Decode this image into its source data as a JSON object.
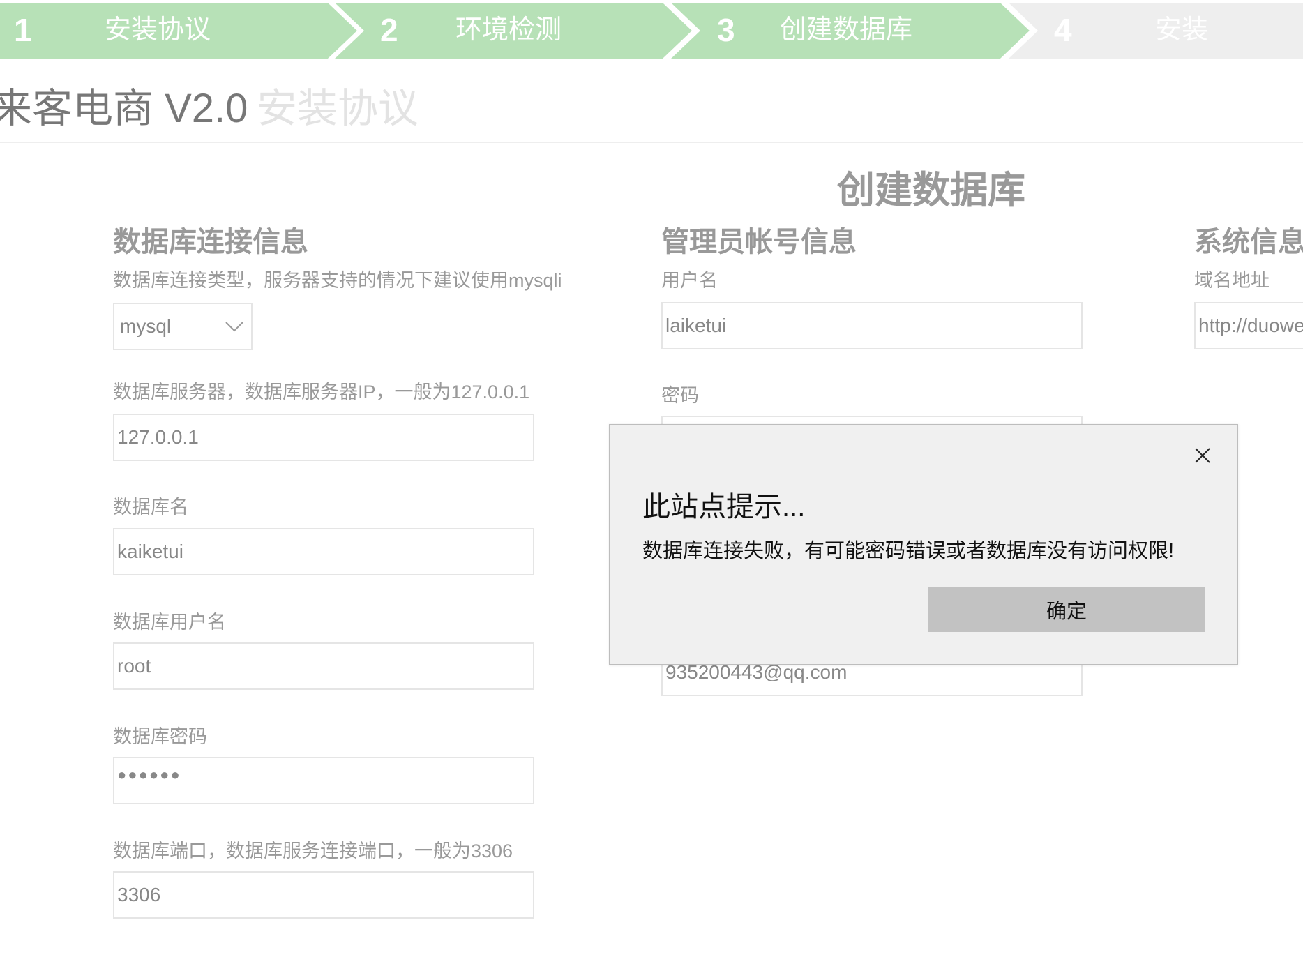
{
  "steps": [
    {
      "number": "1",
      "label": "安装协议",
      "color": "#b7e1b7"
    },
    {
      "number": "2",
      "label": "环境检测",
      "color": "#b7e1b7"
    },
    {
      "number": "3",
      "label": "创建数据库",
      "color": "#b7e1b7"
    },
    {
      "number": "4",
      "label": "安装",
      "color": "#eeeeee"
    }
  ],
  "header": {
    "brand": "来客电商 V2.0",
    "subtitle": "安装协议"
  },
  "page_title": "创建数据库",
  "db_section": {
    "title": "数据库连接信息",
    "type_label": "数据库连接类型，服务器支持的情况下建议使用mysqli",
    "type_value": "mysql",
    "server_label": "数据库服务器，数据库服务器IP，一般为127.0.0.1",
    "server_value": "127.0.0.1",
    "name_label": "数据库名",
    "name_value": "kaiketui",
    "user_label": "数据库用户名",
    "user_value": "root",
    "password_label": "数据库密码",
    "password_value": "●●●●●●",
    "port_label": "数据库端口，数据库服务连接端口，一般为3306",
    "port_value": "3306"
  },
  "admin_section": {
    "title": "管理员帐号信息",
    "username_label": "用户名",
    "username_value": "laiketui",
    "password_label": "密码",
    "email_value": "935200443@qq.com"
  },
  "system_section": {
    "title": "系统信息",
    "domain_label": "域名地址",
    "domain_value": "http://duowei"
  },
  "dialog": {
    "title": "此站点提示...",
    "message": "数据库连接失败，有可能密码错误或者数据库没有访问权限!",
    "ok_label": "确定"
  },
  "colors": {
    "step_active": "#b7e1b7",
    "step_inactive": "#eeeeee",
    "muted_text": "#999999"
  },
  "icons": {
    "select_chevron": "chevron-down-icon",
    "dialog_close": "close-icon"
  }
}
